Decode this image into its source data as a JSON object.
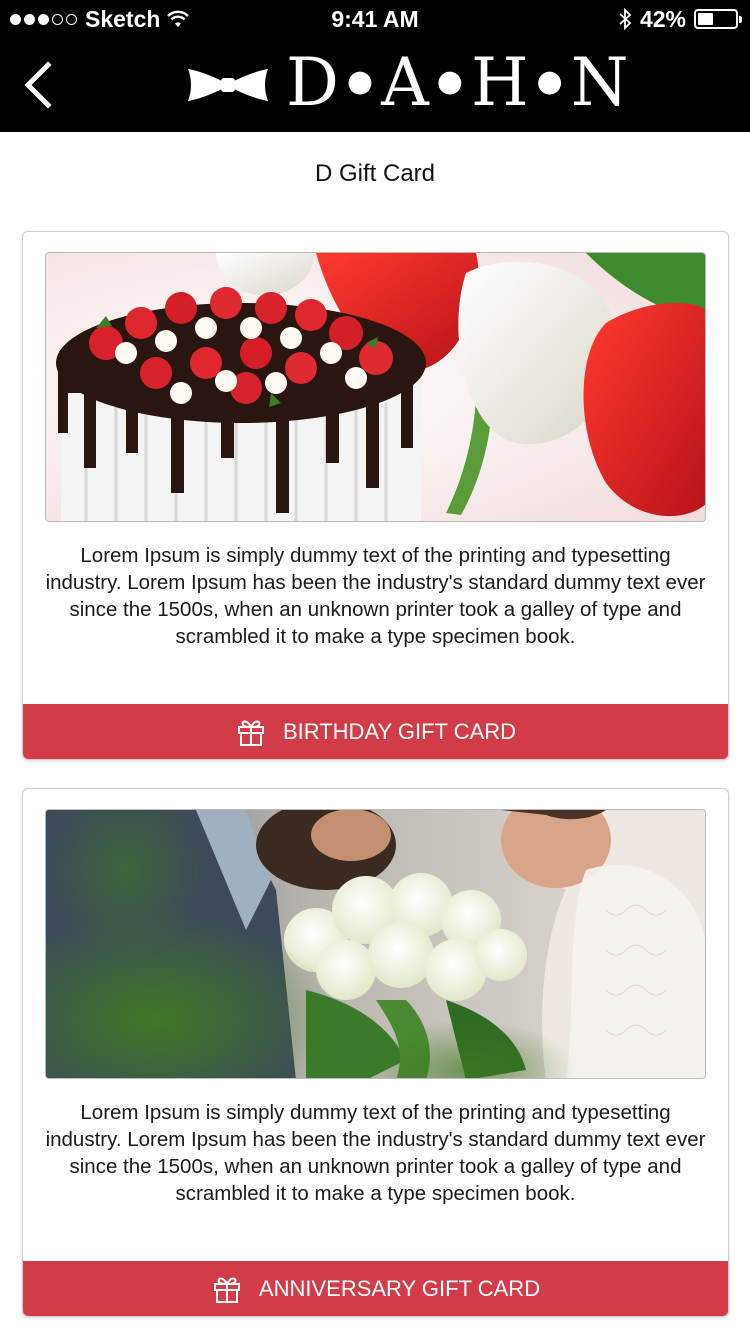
{
  "status_bar": {
    "carrier": "Sketch",
    "time": "9:41 AM",
    "battery_percent": "42%",
    "battery_level": 0.42,
    "signal_bars_filled": 3,
    "signal_bars_total": 5
  },
  "header": {
    "logo_letters": [
      "D",
      "A",
      "H",
      "N"
    ],
    "logo_icon": "bowtie-icon",
    "back_icon": "chevron-left-icon",
    "background": "#000000"
  },
  "page": {
    "title": "D Gift Card"
  },
  "cards": [
    {
      "image": "birthday-cake-and-tulips-photo",
      "description": "Lorem Ipsum is simply dummy text of the printing and typesetting industry. Lorem Ipsum has been the industry's standard dummy text ever since the 1500s, when an unknown printer took a galley of type and scrambled it to make a type specimen book.",
      "button_label": "BIRTHDAY GIFT CARD",
      "button_icon": "gift-icon"
    },
    {
      "image": "wedding-couple-with-roses-photo",
      "description": "Lorem Ipsum is simply dummy text of the printing and typesetting industry. Lorem Ipsum has been the industry's standard dummy text ever since the 1500s, when an unknown printer took a galley of type and scrambled it to make a type specimen book.",
      "button_label": "ANNIVERSARY GIFT CARD",
      "button_icon": "gift-icon"
    }
  ],
  "colors": {
    "accent": "#d23b48",
    "header_bg": "#000000",
    "text": "#1a1a1a"
  }
}
